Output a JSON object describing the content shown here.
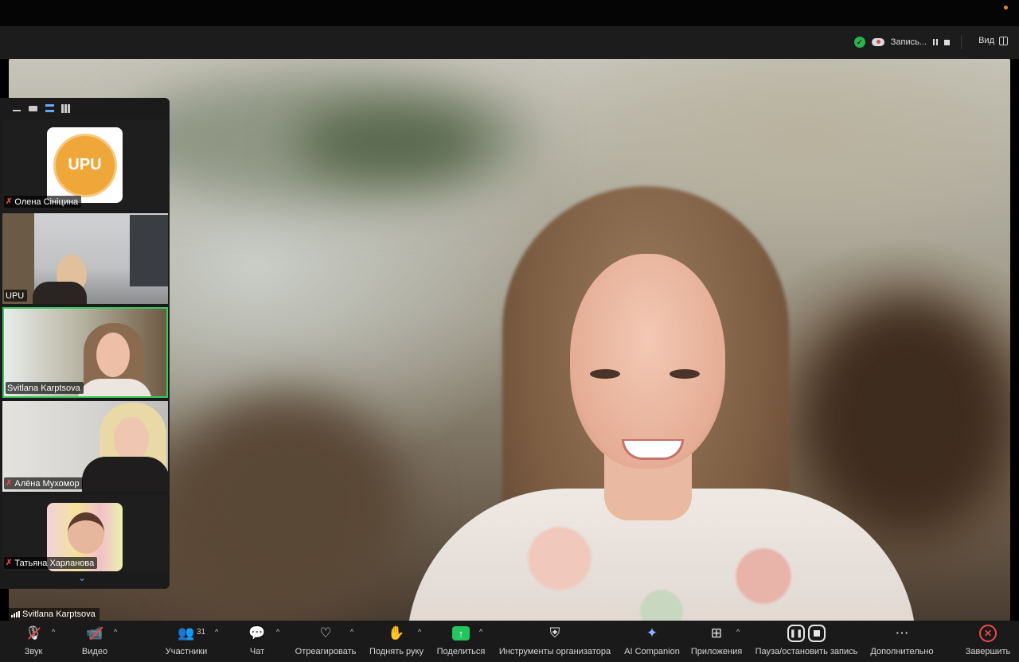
{
  "status": {
    "recording_label": "Запись...",
    "view_label": "Вид"
  },
  "main_speaker": {
    "name": "Svitlana Karptsova"
  },
  "participants_panel": {
    "tiles": [
      {
        "name": "Олена Сініцина",
        "muted": true,
        "logo_text": "UPU"
      },
      {
        "name": "UPU",
        "muted": false
      },
      {
        "name": "Svitlana Karptsova",
        "muted": false,
        "active": true
      },
      {
        "name": "Алёна Мухомор",
        "muted": true
      },
      {
        "name": "Татьяна Харланова",
        "muted": true
      }
    ]
  },
  "toolbar": {
    "audio": "Звук",
    "video": "Видео",
    "participants": "Участники",
    "participants_count": "31",
    "chat": "Чат",
    "react": "Отреагировать",
    "raise_hand": "Поднять руку",
    "share": "Поделиться",
    "host_tools": "Инструменты организатора",
    "ai_companion": "AI Companion",
    "apps": "Приложения",
    "pause_record": "Пауза/остановить запись",
    "more": "Дополнительно",
    "end": "Завершить"
  }
}
